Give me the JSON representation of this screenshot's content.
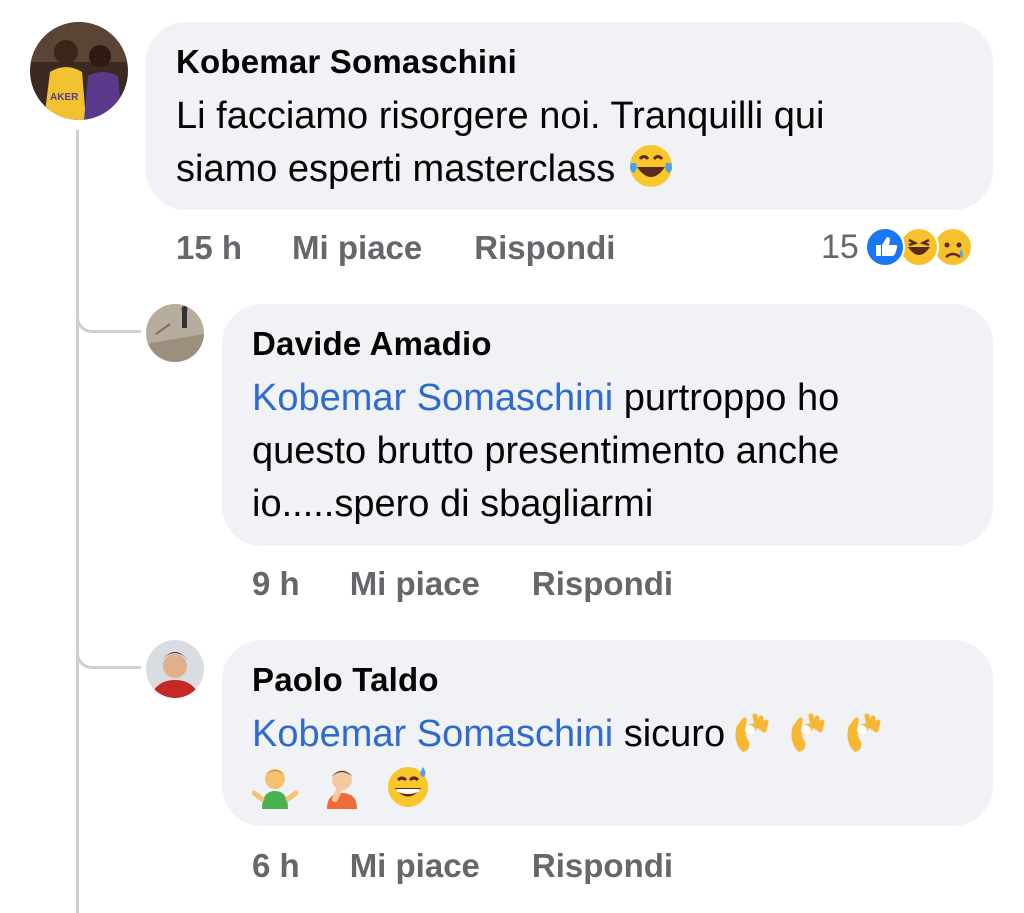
{
  "comments": [
    {
      "author": "Kobemar Somaschini",
      "text_line1": "Li facciamo risorgere noi. Tranquilli qui",
      "text_line2": "siamo esperti masterclass",
      "time": "15 h",
      "like_label": "Mi piace",
      "reply_label": "Rispondi",
      "reaction_count": "15",
      "reaction_icons": [
        "like-icon",
        "laugh-icon",
        "sad-icon"
      ]
    }
  ],
  "replies": [
    {
      "author": "Davide Amadio",
      "mention": "Kobemar Somaschini",
      "text_line1": " purtroppo ho",
      "text_line2": "questo brutto presentimento anche",
      "text_line3": "io.....spero di sbagliarmi",
      "time": "9 h",
      "like_label": "Mi piace",
      "reply_label": "Rispondi"
    },
    {
      "author": "Paolo Taldo",
      "mention": "Kobemar Somaschini",
      "text": " sicuro",
      "emojis_line1": [
        "ok-hand-emoji",
        "ok-hand-emoji",
        "ok-hand-emoji"
      ],
      "emojis_line2": [
        "man-shrugging-emoji",
        "person-facepalming-emoji",
        "grinning-sweat-emoji"
      ],
      "time": "6 h",
      "like_label": "Mi piace",
      "reply_label": "Rispondi"
    }
  ]
}
